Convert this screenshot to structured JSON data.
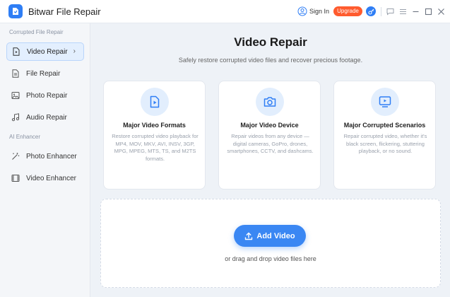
{
  "app": {
    "title": "Bitwar File Repair"
  },
  "titlebar": {
    "signin": "Sign In",
    "upgrade": "Upgrade"
  },
  "colors": {
    "accent": "#2f7ef5",
    "upgrade": "#ff5b2e",
    "active_nav_bg": "#e3effe"
  },
  "sidebar": {
    "sections": [
      {
        "label": "Corrupted File Repair"
      },
      {
        "label": "AI Enhancer"
      }
    ],
    "items": [
      {
        "label": "Video Repair",
        "icon": "video-file-icon",
        "active": true
      },
      {
        "label": "File Repair",
        "icon": "document-icon"
      },
      {
        "label": "Photo Repair",
        "icon": "image-icon"
      },
      {
        "label": "Audio Repair",
        "icon": "music-note-icon"
      },
      {
        "label": "Photo Enhancer",
        "icon": "magic-wand-icon"
      },
      {
        "label": "Video Enhancer",
        "icon": "film-icon"
      }
    ]
  },
  "main": {
    "title": "Video Repair",
    "subtitle": "Safely restore corrupted video files and recover precious footage.",
    "cards": [
      {
        "icon": "video-file-icon",
        "title": "Major Video Formats",
        "desc": "Restore corrupted video playback for MP4, MOV, MKV, AVI, INSV, 3GP, MPG, MPEG, MTS, TS, and M2TS formats."
      },
      {
        "icon": "camera-icon",
        "title": "Major Video Device",
        "desc": "Repair videos from any device — digital cameras, GoPro, drones, smartphones, CCTV, and dashcams."
      },
      {
        "icon": "monitor-play-icon",
        "title": "Major Corrupted Scenarios",
        "desc": "Repair corrupted video, whether it's black screen, flickering, stuttering playback, or no sound."
      }
    ],
    "dropzone": {
      "button": "Add Video",
      "hint": "or drag and drop video files here"
    }
  }
}
